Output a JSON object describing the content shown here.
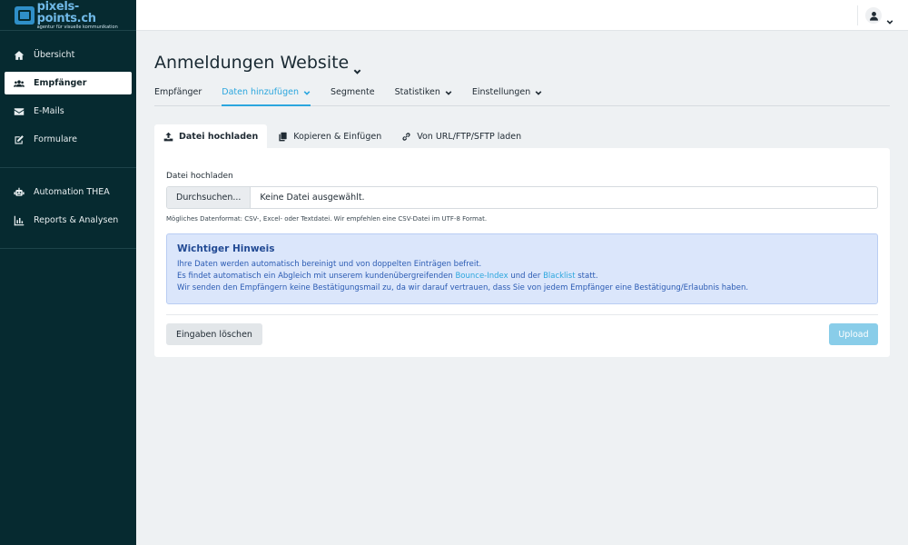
{
  "logo": {
    "name": "pixels-points.ch",
    "tagline": "agentur für visuelle kommunikation"
  },
  "sidebar": {
    "group1": [
      {
        "label": "Übersicht",
        "icon": "home-icon"
      },
      {
        "label": "Empfänger",
        "icon": "users-icon",
        "active": true
      },
      {
        "label": "E-Mails",
        "icon": "envelope-icon"
      },
      {
        "label": "Formulare",
        "icon": "edit-icon"
      }
    ],
    "group2": [
      {
        "label": "Automation THEA",
        "icon": "robot-icon"
      },
      {
        "label": "Reports & Analysen",
        "icon": "bar-chart-icon"
      }
    ]
  },
  "header": {
    "user_icon": "user-icon"
  },
  "page": {
    "title": "Anmeldungen Website"
  },
  "subnav": [
    {
      "label": "Empfänger"
    },
    {
      "label": "Daten hinzufügen",
      "active": true
    },
    {
      "label": "Segmente"
    },
    {
      "label": "Statistiken"
    },
    {
      "label": "Einstellungen"
    }
  ],
  "tabs": [
    {
      "label": "Datei hochladen",
      "icon": "upload-icon",
      "active": true
    },
    {
      "label": "Kopieren & Einfügen",
      "icon": "copy-icon"
    },
    {
      "label": "Von URL/FTP/SFTP laden",
      "icon": "link-icon"
    }
  ],
  "upload": {
    "label": "Datei hochladen",
    "browse_label": "Durchsuchen...",
    "file_name": "Keine Datei ausgewählt.",
    "help": "Mögliches Datenformat: CSV-, Excel- oder Textdatei. Wir empfehlen eine CSV-Datei im UTF-8 Format."
  },
  "notice": {
    "title": "Wichtiger Hinweis",
    "line1": "Ihre Daten werden automatisch bereinigt und von doppelten Einträgen befreit.",
    "line2_a": "Es findet automatisch ein Abgleich mit unserem kundenübergreifenden ",
    "line2_link1": "Bounce-Index",
    "line2_b": " und der ",
    "line2_link2": "Blacklist",
    "line2_c": " statt.",
    "line3": "Wir senden den Empfängern keine Bestätigungsmail zu, da wir darauf vertrauen, dass Sie von jedem Empfänger eine Bestätigung/Erlaubnis haben."
  },
  "actions": {
    "clear_label": "Eingaben löschen",
    "upload_label": "Upload"
  },
  "colors": {
    "sidebar": "#062a30",
    "accent": "#2ba6de",
    "notice_bg": "#dbe6fb",
    "upload_btn": "#89cde9"
  }
}
